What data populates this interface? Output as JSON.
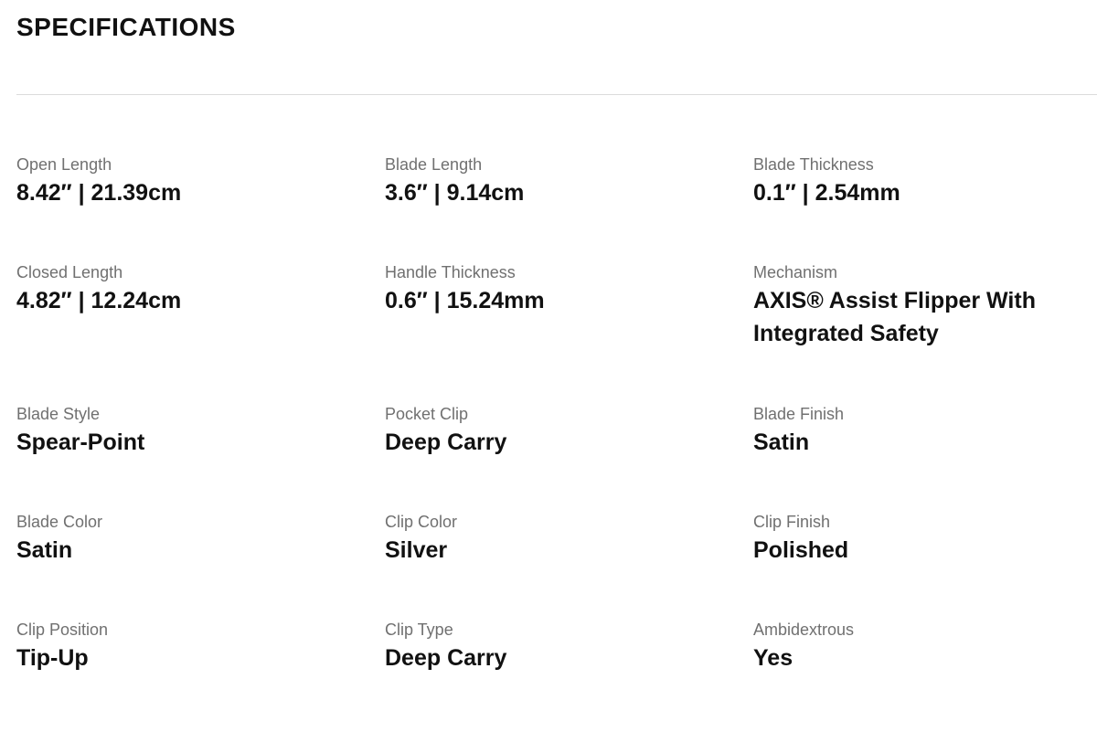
{
  "header": {
    "title": "SPECIFICATIONS"
  },
  "specs": {
    "rows": [
      [
        {
          "label": "Open Length",
          "value": "8.42″ | 21.39cm"
        },
        {
          "label": "Blade Length",
          "value": "3.6″ | 9.14cm"
        },
        {
          "label": "Blade Thickness",
          "value": "0.1″ | 2.54mm"
        }
      ],
      [
        {
          "label": "Closed Length",
          "value": "4.82″ | 12.24cm"
        },
        {
          "label": "Handle Thickness",
          "value": "0.6″ | 15.24mm"
        },
        {
          "label": "Mechanism",
          "value": "AXIS® Assist Flipper With Integrated Safety"
        }
      ],
      [
        {
          "label": "Blade Style",
          "value": "Spear-Point"
        },
        {
          "label": "Pocket Clip",
          "value": "Deep Carry"
        },
        {
          "label": "Blade Finish",
          "value": "Satin"
        }
      ],
      [
        {
          "label": "Blade Color",
          "value": "Satin"
        },
        {
          "label": "Clip Color",
          "value": "Silver"
        },
        {
          "label": "Clip Finish",
          "value": "Polished"
        }
      ],
      [
        {
          "label": "Clip Position",
          "value": "Tip-Up"
        },
        {
          "label": "Clip Type",
          "value": "Deep Carry"
        },
        {
          "label": "Ambidextrous",
          "value": "Yes"
        }
      ]
    ]
  }
}
